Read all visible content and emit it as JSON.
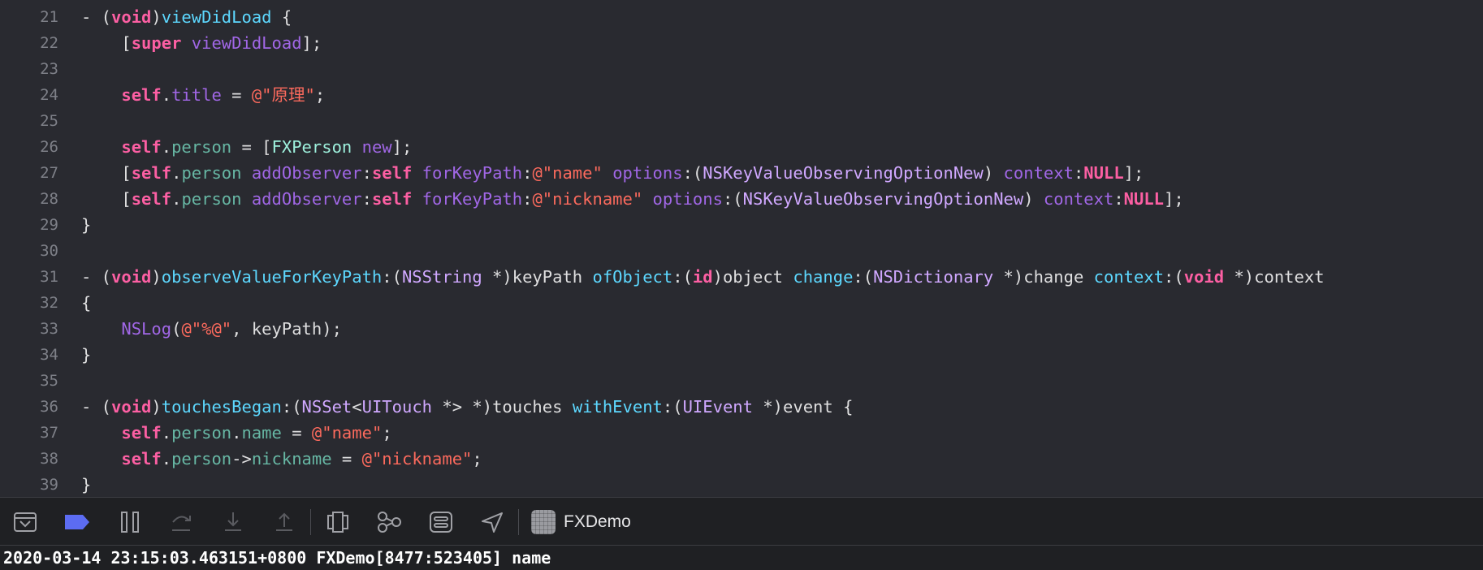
{
  "editor": {
    "lines": [
      {
        "num": "21",
        "tokens": [
          [
            "plain",
            "- ("
          ],
          [
            "kw",
            "void"
          ],
          [
            "plain",
            ")"
          ],
          [
            "dec",
            "viewDidLoad"
          ],
          [
            "plain",
            " {"
          ]
        ]
      },
      {
        "num": "22",
        "tokens": [
          [
            "plain",
            "    ["
          ],
          [
            "kw",
            "super"
          ],
          [
            "plain",
            " "
          ],
          [
            "pmeth",
            "viewDidLoad"
          ],
          [
            "plain",
            "];"
          ]
        ]
      },
      {
        "num": "23",
        "tokens": []
      },
      {
        "num": "24",
        "tokens": [
          [
            "plain",
            "    "
          ],
          [
            "kw",
            "self"
          ],
          [
            "plain",
            "."
          ],
          [
            "pprop",
            "title"
          ],
          [
            "plain",
            " = "
          ],
          [
            "str",
            "@\"原理\""
          ],
          [
            "plain",
            ";"
          ]
        ]
      },
      {
        "num": "25",
        "tokens": []
      },
      {
        "num": "26",
        "tokens": [
          [
            "plain",
            "    "
          ],
          [
            "kw",
            "self"
          ],
          [
            "plain",
            "."
          ],
          [
            "prop",
            "person"
          ],
          [
            "plain",
            " = ["
          ],
          [
            "cls",
            "FXPerson"
          ],
          [
            "plain",
            " "
          ],
          [
            "pmeth",
            "new"
          ],
          [
            "plain",
            "];"
          ]
        ]
      },
      {
        "num": "27",
        "tokens": [
          [
            "plain",
            "    ["
          ],
          [
            "kw",
            "self"
          ],
          [
            "plain",
            "."
          ],
          [
            "prop",
            "person"
          ],
          [
            "plain",
            " "
          ],
          [
            "pmeth",
            "addObserver"
          ],
          [
            "plain",
            ":"
          ],
          [
            "kw",
            "self"
          ],
          [
            "plain",
            " "
          ],
          [
            "pmeth",
            "forKeyPath"
          ],
          [
            "plain",
            ":"
          ],
          [
            "str",
            "@\"name\""
          ],
          [
            "plain",
            " "
          ],
          [
            "pmeth",
            "options"
          ],
          [
            "plain",
            ":("
          ],
          [
            "ptype",
            "NSKeyValueObservingOptionNew"
          ],
          [
            "plain",
            ") "
          ],
          [
            "pmeth",
            "context"
          ],
          [
            "plain",
            ":"
          ],
          [
            "kw",
            "NULL"
          ],
          [
            "plain",
            "];"
          ]
        ]
      },
      {
        "num": "28",
        "tokens": [
          [
            "plain",
            "    ["
          ],
          [
            "kw",
            "self"
          ],
          [
            "plain",
            "."
          ],
          [
            "prop",
            "person"
          ],
          [
            "plain",
            " "
          ],
          [
            "pmeth",
            "addObserver"
          ],
          [
            "plain",
            ":"
          ],
          [
            "kw",
            "self"
          ],
          [
            "plain",
            " "
          ],
          [
            "pmeth",
            "forKeyPath"
          ],
          [
            "plain",
            ":"
          ],
          [
            "str",
            "@\"nickname\""
          ],
          [
            "plain",
            " "
          ],
          [
            "pmeth",
            "options"
          ],
          [
            "plain",
            ":("
          ],
          [
            "ptype",
            "NSKeyValueObservingOptionNew"
          ],
          [
            "plain",
            ") "
          ],
          [
            "pmeth",
            "context"
          ],
          [
            "plain",
            ":"
          ],
          [
            "kw",
            "NULL"
          ],
          [
            "plain",
            "];"
          ]
        ]
      },
      {
        "num": "29",
        "tokens": [
          [
            "plain",
            "}"
          ]
        ]
      },
      {
        "num": "30",
        "tokens": []
      },
      {
        "num": "31",
        "tokens": [
          [
            "plain",
            "- ("
          ],
          [
            "kw",
            "void"
          ],
          [
            "plain",
            ")"
          ],
          [
            "dec",
            "observeValueForKeyPath"
          ],
          [
            "plain",
            ":("
          ],
          [
            "ptype",
            "NSString"
          ],
          [
            "plain",
            " *)keyPath "
          ],
          [
            "dec",
            "ofObject"
          ],
          [
            "plain",
            ":("
          ],
          [
            "kw",
            "id"
          ],
          [
            "plain",
            ")object "
          ],
          [
            "dec",
            "change"
          ],
          [
            "plain",
            ":("
          ],
          [
            "ptype",
            "NSDictionary"
          ],
          [
            "plain",
            " *)change "
          ],
          [
            "dec",
            "context"
          ],
          [
            "plain",
            ":("
          ],
          [
            "kw",
            "void"
          ],
          [
            "plain",
            " *)context"
          ]
        ]
      },
      {
        "num": "32",
        "tokens": [
          [
            "plain",
            "{"
          ]
        ]
      },
      {
        "num": "33",
        "tokens": [
          [
            "plain",
            "    "
          ],
          [
            "pmeth",
            "NSLog"
          ],
          [
            "plain",
            "("
          ],
          [
            "str",
            "@\"%@\""
          ],
          [
            "plain",
            ", keyPath);"
          ]
        ]
      },
      {
        "num": "34",
        "tokens": [
          [
            "plain",
            "}"
          ]
        ]
      },
      {
        "num": "35",
        "tokens": []
      },
      {
        "num": "36",
        "tokens": [
          [
            "plain",
            "- ("
          ],
          [
            "kw",
            "void"
          ],
          [
            "plain",
            ")"
          ],
          [
            "dec",
            "touchesBegan"
          ],
          [
            "plain",
            ":("
          ],
          [
            "ptype",
            "NSSet"
          ],
          [
            "plain",
            "<"
          ],
          [
            "ptype",
            "UITouch"
          ],
          [
            "plain",
            " *> *)touches "
          ],
          [
            "dec",
            "withEvent"
          ],
          [
            "plain",
            ":("
          ],
          [
            "ptype",
            "UIEvent"
          ],
          [
            "plain",
            " *)event {"
          ]
        ]
      },
      {
        "num": "37",
        "tokens": [
          [
            "plain",
            "    "
          ],
          [
            "kw",
            "self"
          ],
          [
            "plain",
            "."
          ],
          [
            "prop",
            "person"
          ],
          [
            "plain",
            "."
          ],
          [
            "prop",
            "name"
          ],
          [
            "plain",
            " = "
          ],
          [
            "str",
            "@\"name\""
          ],
          [
            "plain",
            ";"
          ]
        ]
      },
      {
        "num": "38",
        "tokens": [
          [
            "plain",
            "    "
          ],
          [
            "kw",
            "self"
          ],
          [
            "plain",
            "."
          ],
          [
            "prop",
            "person"
          ],
          [
            "plain",
            "->"
          ],
          [
            "prop",
            "nickname"
          ],
          [
            "plain",
            " = "
          ],
          [
            "str",
            "@\"nickname\""
          ],
          [
            "plain",
            ";"
          ]
        ]
      },
      {
        "num": "39",
        "tokens": [
          [
            "plain",
            "}"
          ]
        ]
      }
    ]
  },
  "debug_bar": {
    "icons": [
      "hide-debug-area-icon",
      "breakpoints-toggle-icon",
      "pause-icon",
      "step-over-icon",
      "step-into-icon",
      "step-out-icon",
      "view-hierarchy-icon",
      "memory-graph-icon",
      "environment-overrides-icon",
      "simulate-location-icon"
    ],
    "target_name": "FXDemo"
  },
  "console": {
    "output": "2020-03-14 23:15:03.463151+0800 FXDemo[8477:523405] name"
  }
}
